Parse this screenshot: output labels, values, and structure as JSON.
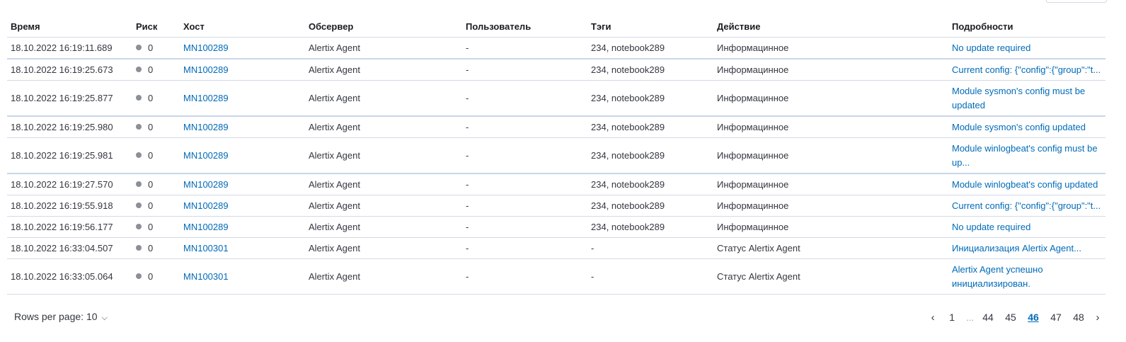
{
  "columns": [
    "Время",
    "Риск",
    "Хост",
    "Обсервер",
    "Пользователь",
    "Тэги",
    "Действие",
    "Подробности"
  ],
  "rows": [
    {
      "time": "18.10.2022 16:19:11.689",
      "risk": "0",
      "host": "MN100289",
      "observer": "Alertix Agent",
      "user": "-",
      "tags": "234, notebook289",
      "action": "Информацинное",
      "details": "No update required"
    },
    {
      "time": "18.10.2022 16:19:25.673",
      "risk": "0",
      "host": "MN100289",
      "observer": "Alertix Agent",
      "user": "-",
      "tags": "234, notebook289",
      "action": "Информацинное",
      "details": "Current config: {\"config\":{\"group\":\"t..."
    },
    {
      "time": "18.10.2022 16:19:25.877",
      "risk": "0",
      "host": "MN100289",
      "observer": "Alertix Agent",
      "user": "-",
      "tags": "234, notebook289",
      "action": "Информацинное",
      "details": "Module sysmon's config must be updated"
    },
    {
      "time": "18.10.2022 16:19:25.980",
      "risk": "0",
      "host": "MN100289",
      "observer": "Alertix Agent",
      "user": "-",
      "tags": "234, notebook289",
      "action": "Информацинное",
      "details": "Module sysmon's config updated"
    },
    {
      "time": "18.10.2022 16:19:25.981",
      "risk": "0",
      "host": "MN100289",
      "observer": "Alertix Agent",
      "user": "-",
      "tags": "234, notebook289",
      "action": "Информацинное",
      "details": "Module winlogbeat's config must be up..."
    },
    {
      "time": "18.10.2022 16:19:27.570",
      "risk": "0",
      "host": "MN100289",
      "observer": "Alertix Agent",
      "user": "-",
      "tags": "234, notebook289",
      "action": "Информацинное",
      "details": "Module winlogbeat's config updated"
    },
    {
      "time": "18.10.2022 16:19:55.918",
      "risk": "0",
      "host": "MN100289",
      "observer": "Alertix Agent",
      "user": "-",
      "tags": "234, notebook289",
      "action": "Информацинное",
      "details": "Current config: {\"config\":{\"group\":\"t..."
    },
    {
      "time": "18.10.2022 16:19:56.177",
      "risk": "0",
      "host": "MN100289",
      "observer": "Alertix Agent",
      "user": "-",
      "tags": "234, notebook289",
      "action": "Информацинное",
      "details": "No update required"
    },
    {
      "time": "18.10.2022 16:33:04.507",
      "risk": "0",
      "host": "MN100301",
      "observer": "Alertix Agent",
      "user": "-",
      "tags": "-",
      "action": "Статус Alertix Agent",
      "details": "Инициализация Alertix Agent..."
    },
    {
      "time": "18.10.2022 16:33:05.064",
      "risk": "0",
      "host": "MN100301",
      "observer": "Alertix Agent",
      "user": "-",
      "tags": "-",
      "action": "Статус Alertix Agent",
      "details": "Alertix Agent успешно инициализирован."
    }
  ],
  "footer": {
    "rows_per_page_label": "Rows per page: 10"
  },
  "pagination": {
    "pages": [
      "1",
      "44",
      "45",
      "46",
      "47",
      "48"
    ],
    "ellipsis": "...",
    "active_page": "46"
  },
  "colors": {
    "link": "#006bb8",
    "risk_dot": "#8a8f98",
    "border": "#d3dae6"
  },
  "icons": {
    "risk": "dot-icon",
    "rows_per_page": "chevron-down-icon",
    "prev": "chevron-left-icon",
    "next": "chevron-right-icon"
  }
}
